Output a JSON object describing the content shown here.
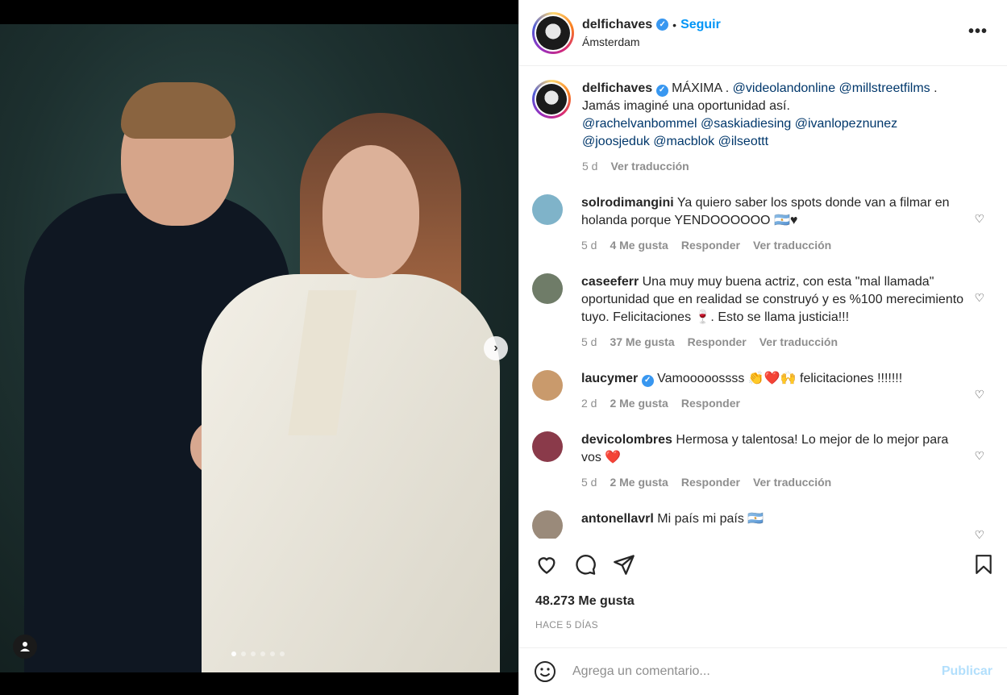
{
  "header": {
    "username": "delfichaves",
    "separator": "•",
    "follow_label": "Seguir",
    "location": "Ámsterdam",
    "more_icon": "more-horizontal-icon"
  },
  "caption": {
    "username": "delfichaves",
    "text_lead": "MÁXIMA .",
    "mention_1": "@videolandonline",
    "mention_2": "@millstreetfilms",
    "text_after": ".",
    "line2": "Jamás imaginé una oportunidad así.",
    "mention_3": "@rachelvanbommel",
    "mention_4": "@saskiadiesing",
    "mention_5": "@ivanlopeznunez",
    "mention_6": "@joosjeduk",
    "mention_7": "@macblok",
    "mention_8": "@ilseottt",
    "age": "5 d",
    "translate": "Ver traducción"
  },
  "comments": [
    {
      "user": "solrodimangini",
      "text": "Ya quiero saber los spots donde van a filmar en holanda porque YENDOOOOOO 🇦🇷♥",
      "age": "5 d",
      "likes": "4 Me gusta",
      "reply": "Responder",
      "translate": "Ver traducción",
      "avatar_color": "#7fb3c9"
    },
    {
      "user": "caseeferr",
      "text": "Una muy muy buena actriz, con esta \"mal llamada\" oportunidad que en realidad se construyó y es %100 merecimiento tuyo. Felicitaciones 🍷. Esto se llama justicia!!!",
      "age": "5 d",
      "likes": "37 Me gusta",
      "reply": "Responder",
      "translate": "Ver traducción",
      "avatar_color": "#6f7c68"
    },
    {
      "user": "laucymer",
      "text": "Vamooooossss 👏❤️🙌 felicitaciones !!!!!!!",
      "age": "2 d",
      "likes": "2 Me gusta",
      "reply": "Responder",
      "translate": "",
      "avatar_color": "#c99a6c"
    },
    {
      "user": "devicolombres",
      "text": "Hermosa y talentosa! Lo mejor de lo mejor para vos ❤️",
      "age": "5 d",
      "likes": "2 Me gusta",
      "reply": "Responder",
      "translate": "Ver traducción",
      "avatar_color": "#8a3a4a"
    },
    {
      "user": "antonellavrl",
      "text": "Mi país mi país 🇦🇷",
      "age": "",
      "likes": "",
      "reply": "",
      "translate": "",
      "avatar_color": "#9a8a7a"
    }
  ],
  "stats": {
    "likes": "48.273 Me gusta",
    "time": "HACE 5 DÍAS"
  },
  "composer": {
    "placeholder": "Agrega un comentario...",
    "publish_label": "Publicar"
  },
  "carousel": {
    "total": 6,
    "active_index": 0
  }
}
